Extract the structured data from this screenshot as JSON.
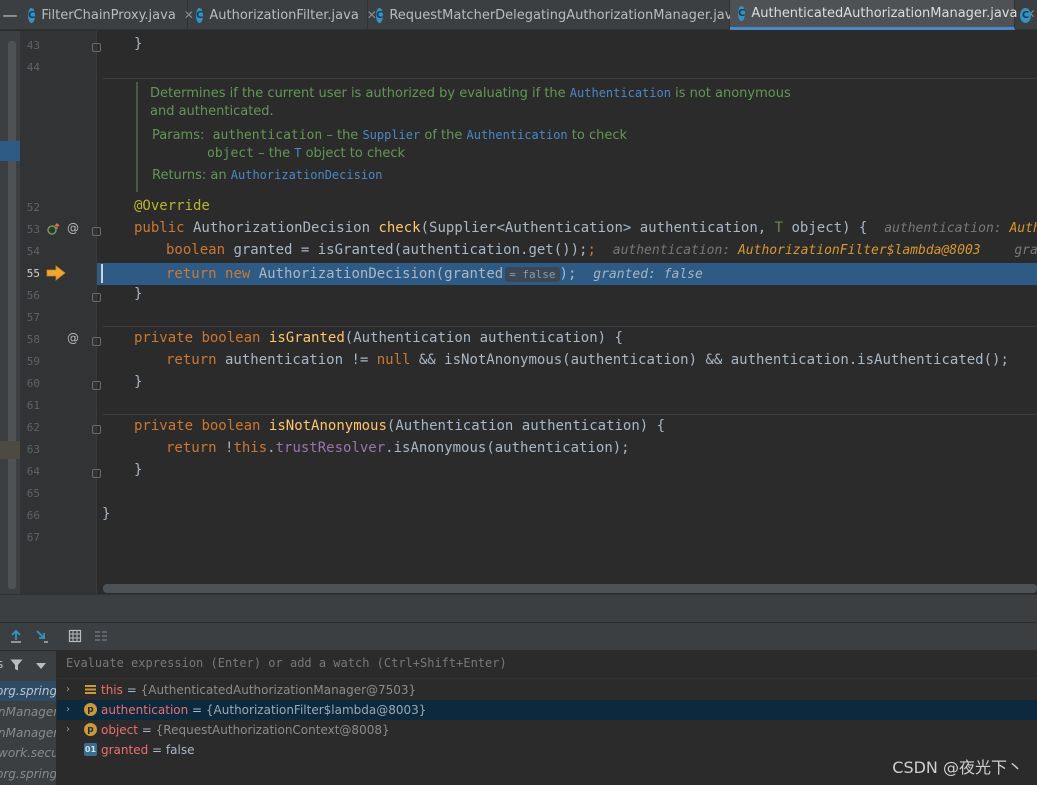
{
  "tabs": [
    {
      "name": "FilterChainProxy.java",
      "active": false
    },
    {
      "name": "AuthorizationFilter.java",
      "active": false
    },
    {
      "name": "RequestMatcherDelegatingAuthorizationManager.java",
      "active": false
    },
    {
      "name": "AuthenticatedAuthorizationManager.java",
      "active": true
    }
  ],
  "tab_icon_letter": "C",
  "tab_close_glyph": "✕",
  "collapse_glyph": "—",
  "line_numbers": {
    "l43": "43",
    "l44": "44",
    "l52": "52",
    "l53": "53",
    "l54": "54",
    "l55": "55",
    "l56": "56",
    "l57": "57",
    "l58": "58",
    "l59": "59",
    "l60": "60",
    "l61": "61",
    "l62": "62",
    "l63": "63",
    "l64": "64",
    "l65": "65",
    "l66": "66",
    "l67": "67"
  },
  "gutter": {
    "override_marker": "@",
    "overridden_marker": "@"
  },
  "doc": {
    "line1_a": "Determines if the current user is authorized by evaluating if the ",
    "line1_code": "Authentication",
    "line1_b": " is not anonymous",
    "line2": "and authenticated.",
    "params_label": "Params:",
    "p1_name": "authentication",
    "p1_a": " – the ",
    "p1_code1": "Supplier",
    "p1_b": " of the ",
    "p1_code2": "Authentication",
    "p1_c": " to check",
    "p2_name": "object",
    "p2_a": " – the ",
    "p2_code": "T",
    "p2_b": " object to check",
    "returns_label": "Returns:",
    "returns_a": " an ",
    "returns_code": "AuthorizationDecision"
  },
  "code": {
    "c43": "}",
    "c52": "@Override",
    "c53_kw": "public",
    "c53_type": " AuthorizationDecision ",
    "c53_fn": "check",
    "c53_params": "(Supplier<Authentication> authentication, ",
    "c53_t": "T",
    "c53_end": " object) {",
    "c53_hint": "authentication: ",
    "c53_hintv": "Authoriz",
    "c54_kw": "boolean",
    "c54_rest": " granted = isGranted(authentication.get());",
    "c54_hint": "authentication: ",
    "c54_hintv": "AuthorizationFilter$lambda@8003",
    "c54_hint2": "grante",
    "c55_kw1": "return",
    "c55_kw2": "new",
    "c55_rest": " AuthorizationDecision(granted",
    "c55_inlay": "= false",
    "c55_end": ");",
    "c55_hint": "granted: false",
    "c56": "}",
    "c58_kw1": "private",
    "c58_kw2": "boolean",
    "c58_fn": "isGranted",
    "c58_rest": "(Authentication authentication) {",
    "c59_kw1": "return",
    "c59_a": " authentication != ",
    "c59_null": "null",
    "c59_b": " && isNotAnonymous(authentication) && authentication.isAuthenticated();",
    "c60": "}",
    "c62_kw1": "private",
    "c62_kw2": "boolean",
    "c62_fn": "isNotAnonymous",
    "c62_rest": "(Authentication authentication) {",
    "c63_kw1": "return",
    "c63_a": " !",
    "c63_this": "this",
    "c63_dot": ".",
    "c63_field": "trustResolver",
    "c63_b": ".isAnonymous(authentication);",
    "c64": "}",
    "c66": "}"
  },
  "debug": {
    "watch_placeholder": "Evaluate expression (Enter) or add a watch (Ctrl+Shift+Enter)",
    "frames": [
      {
        "text": "org.springfr",
        "selected": true
      },
      {
        "text": "nManager",
        "selected": false
      },
      {
        "text": "nManager",
        "selected": false
      },
      {
        "text": "work.secur",
        "selected": false
      },
      {
        "text": "org.springf",
        "selected": false
      }
    ],
    "variables": [
      {
        "name": "this",
        "eq": " = ",
        "value": "{AuthenticatedAuthorizationManager@7503}",
        "icon": "field-icon",
        "expandable": true,
        "selected": false
      },
      {
        "name": "authentication",
        "eq": " = ",
        "value": "{AuthorizationFilter$lambda@8003}",
        "icon": "p",
        "expandable": true,
        "selected": true
      },
      {
        "name": "object",
        "eq": " = ",
        "value": "{RequestAuthorizationContext@8008}",
        "icon": "p",
        "expandable": true,
        "selected": false
      },
      {
        "name": "granted",
        "eq": " = ",
        "value": "false",
        "icon": "01",
        "expandable": false,
        "selected": false
      }
    ],
    "expand_glyph": "›"
  },
  "watermark": "CSDN @夜光下丶",
  "colors": {
    "execution_line": "#2d5b85",
    "keyword": "#cc7832",
    "function": "#ffc66d",
    "annotation": "#bbb529",
    "doc": "#629755",
    "var_name": "#ee6e6e"
  }
}
